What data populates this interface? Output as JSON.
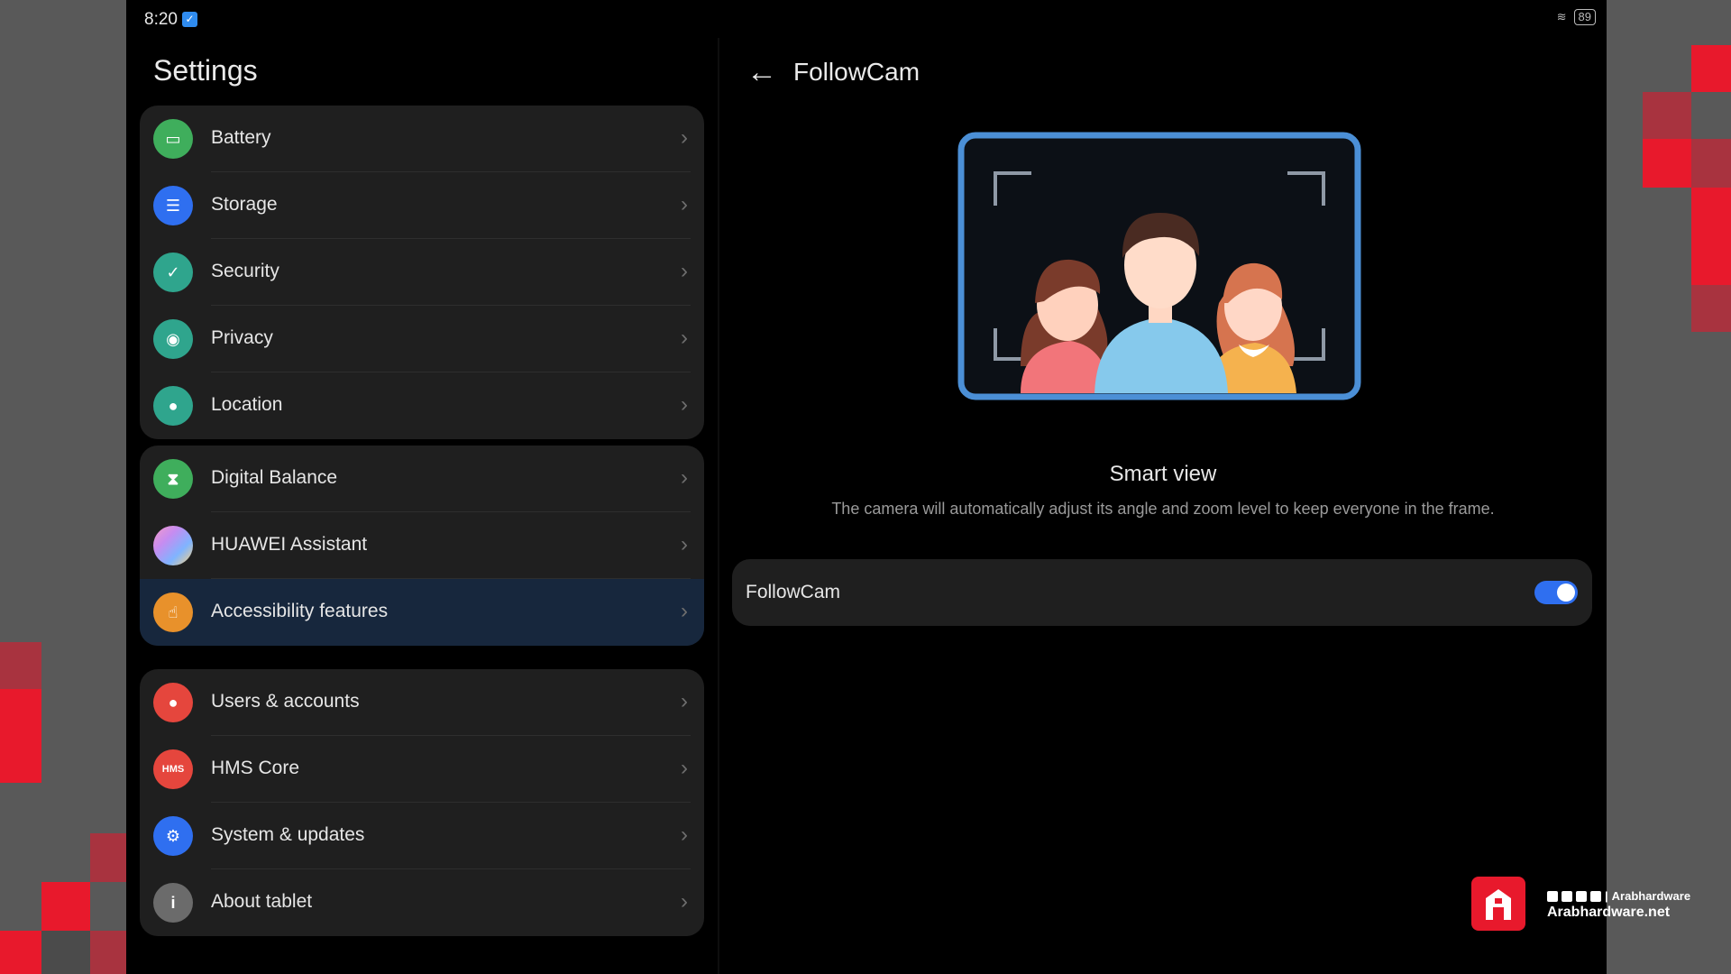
{
  "status": {
    "time": "8:20",
    "battery": "89"
  },
  "settings": {
    "title": "Settings",
    "groups": [
      [
        {
          "label": "Battery",
          "icon": "battery-icon",
          "color": "#3fae5c"
        },
        {
          "label": "Storage",
          "icon": "storage-icon",
          "color": "#2f6ff0"
        },
        {
          "label": "Security",
          "icon": "shield-icon",
          "color": "#2fa58d"
        },
        {
          "label": "Privacy",
          "icon": "privacy-icon",
          "color": "#2fa58d"
        },
        {
          "label": "Location",
          "icon": "location-pin-icon",
          "color": "#2fa58d"
        }
      ],
      [
        {
          "label": "Digital Balance",
          "icon": "hourglass-icon",
          "color": "#3fae5c"
        },
        {
          "label": "HUAWEI Assistant",
          "icon": "assistant-icon",
          "color": "#c68cf0"
        },
        {
          "label": "Accessibility features",
          "icon": "hand-icon",
          "color": "#e8912b"
        }
      ],
      [
        {
          "label": "Users & accounts",
          "icon": "user-icon",
          "color": "#e5463d"
        },
        {
          "label": "HMS Core",
          "icon": "hms-icon",
          "color": "#e5463d"
        },
        {
          "label": "System & updates",
          "icon": "gear-icon",
          "color": "#2f6ff0"
        },
        {
          "label": "About tablet",
          "icon": "info-icon",
          "color": "#6b6b6b"
        }
      ]
    ]
  },
  "detail": {
    "title": "FollowCam",
    "smart_view_title": "Smart view",
    "smart_view_desc": "The camera will automatically adjust its angle and zoom level to keep everyone in the frame.",
    "toggle_label": "FollowCam",
    "toggle_on": true
  },
  "watermark": {
    "line1": "Arabhardware",
    "line2": "Arabhardware.net"
  },
  "colors": {
    "accent": "#2f6ff0",
    "brand_red": "#e8192c"
  }
}
